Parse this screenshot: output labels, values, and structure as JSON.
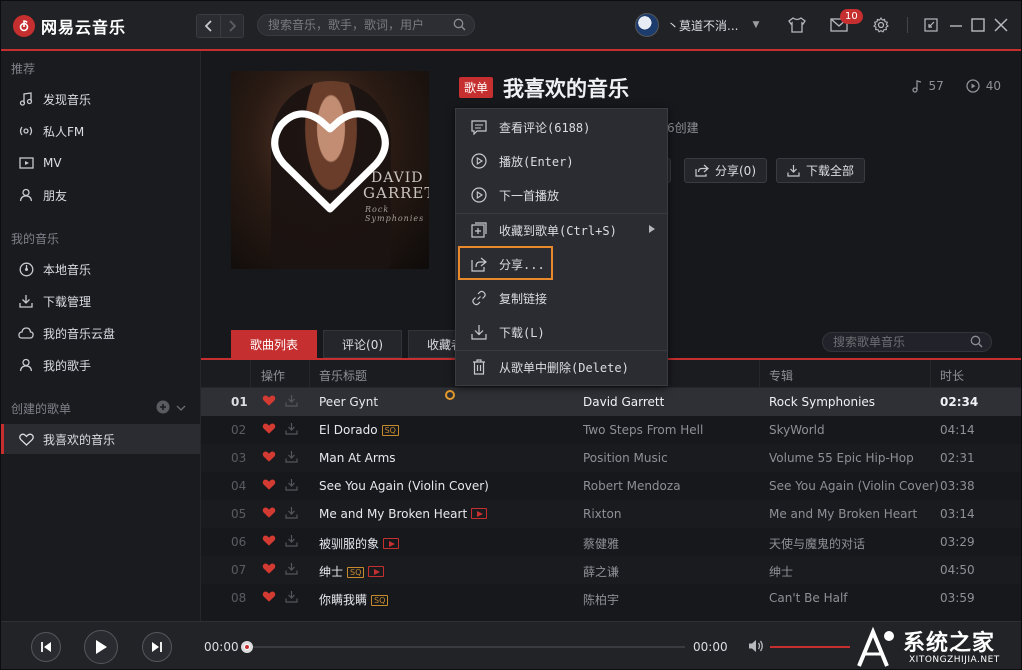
{
  "app": {
    "title": "网易云音乐",
    "logo_glyph": "⑥"
  },
  "titlebar": {
    "search_placeholder": "搜索音乐，歌手，歌词，用户",
    "username": "丶莫道不消...",
    "mail_badge": "10"
  },
  "sidebar": {
    "section_recommend": "推荐",
    "recommend_items": [
      {
        "label": "发现音乐",
        "icon": "music-note-icon"
      },
      {
        "label": "私人FM",
        "icon": "radio-icon"
      },
      {
        "label": "MV",
        "icon": "video-icon"
      },
      {
        "label": "朋友",
        "icon": "friends-icon"
      }
    ],
    "section_my_music": "我的音乐",
    "my_music_items": [
      {
        "label": "本地音乐",
        "icon": "disc-icon"
      },
      {
        "label": "下载管理",
        "icon": "download-icon"
      },
      {
        "label": "我的音乐云盘",
        "icon": "cloud-icon"
      },
      {
        "label": "我的歌手",
        "icon": "singer-icon"
      }
    ],
    "section_created": "创建的歌单",
    "created_items": [
      {
        "label": "我喜欢的音乐",
        "icon": "heart-icon",
        "active": true
      }
    ]
  },
  "playlist": {
    "tag": "歌单",
    "title": "我喜欢的音乐",
    "song_count": "57",
    "play_count": "40",
    "created_suffix": "6创建",
    "cover_text_line1": "DAVID",
    "cover_text_line2": "GARRETT",
    "cover_text_line3": "Rock Symphonies",
    "buttons": {
      "share": "分享(0)",
      "download_all": "下载全部"
    },
    "tabs": [
      "歌曲列表",
      "评论(0)",
      "收藏者"
    ],
    "search_placeholder": "搜索歌单音乐"
  },
  "table": {
    "headers": {
      "ops": "操作",
      "title": "音乐标题",
      "artist": "",
      "album": "专辑",
      "duration": "时长"
    },
    "rows": [
      {
        "num": "01",
        "title": "Peer Gynt",
        "sq": false,
        "mv": false,
        "artist": "David Garrett",
        "album": "Rock Symphonies",
        "duration": "02:34",
        "selected": true
      },
      {
        "num": "02",
        "title": "El Dorado",
        "sq": true,
        "mv": false,
        "artist": "Two Steps From Hell",
        "album": "SkyWorld",
        "duration": "04:14"
      },
      {
        "num": "03",
        "title": "Man At Arms",
        "sq": false,
        "mv": false,
        "artist": "Position Music",
        "album": "Volume 55 Epic Hip-Hop",
        "duration": "02:31"
      },
      {
        "num": "04",
        "title": "See You Again (Violin Cover)",
        "sq": false,
        "mv": false,
        "artist": "Robert Mendoza",
        "album": "See You Again (Violin Cover)",
        "duration": "03:38"
      },
      {
        "num": "05",
        "title": "Me and My Broken Heart",
        "sq": false,
        "mv": true,
        "artist": "Rixton",
        "album": "Me and My Broken Heart",
        "duration": "03:14"
      },
      {
        "num": "06",
        "title": "被驯服的象",
        "sq": false,
        "mv": true,
        "artist": "蔡健雅",
        "album": "天使与魔鬼的对话",
        "duration": "03:29"
      },
      {
        "num": "07",
        "title": "绅士",
        "sq": true,
        "mv": true,
        "artist": "薛之谦",
        "album": "绅士",
        "duration": "04:50"
      },
      {
        "num": "08",
        "title": "你瞒我瞒",
        "sq": true,
        "mv": false,
        "artist": "陈柏宇",
        "album": "Can't Be Half",
        "duration": "03:59"
      }
    ],
    "sq_label": "SQ"
  },
  "context_menu": {
    "items": [
      {
        "label": "查看评论(6188)",
        "icon": "comment-icon"
      },
      {
        "label": "播放(Enter)",
        "icon": "play-circle-icon"
      },
      {
        "label": "下一首播放",
        "icon": "play-next-icon"
      },
      {
        "label": "收藏到歌单(Ctrl+S)",
        "icon": "add-to-playlist-icon",
        "submenu": true
      },
      {
        "label": "分享...",
        "icon": "share-icon",
        "highlighted": true
      },
      {
        "label": "复制链接",
        "icon": "link-icon"
      },
      {
        "label": "下载(L)",
        "icon": "download-icon"
      },
      {
        "label": "从歌单中删除(Delete)",
        "icon": "trash-icon"
      }
    ]
  },
  "player": {
    "current_time": "00:00",
    "total_time": "00:00",
    "progress": 0
  },
  "watermark": {
    "title": "系统之家",
    "url": "XITONGZHIJIA.NET"
  },
  "colors": {
    "accent": "#c62f2f",
    "highlight_box": "#e8892b",
    "background": "#16181c"
  }
}
